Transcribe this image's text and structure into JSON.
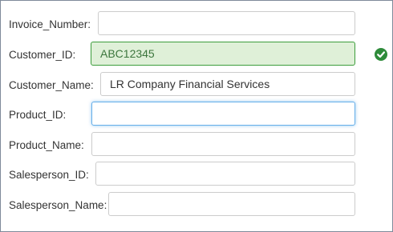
{
  "form": {
    "fields": [
      {
        "label": "Invoice_Number:",
        "value": ""
      },
      {
        "label": "Customer_ID:",
        "value": "ABC12345",
        "status": "valid"
      },
      {
        "label": "Customer_Name:",
        "value": "LR Company Financial Services"
      },
      {
        "label": "Product_ID:",
        "value": "",
        "state": "focused"
      },
      {
        "label": "Product_Name:",
        "value": ""
      },
      {
        "label": "Salesperson_ID:",
        "value": ""
      },
      {
        "label": "Salesperson_Name:",
        "value": ""
      }
    ],
    "valid_icon": "check-circle-icon",
    "colors": {
      "valid_bg": "#dff0d8",
      "valid_border": "#3c9d3c",
      "valid_text": "#3c763d",
      "focus_border": "#66afe9",
      "label_text": "#333333"
    }
  }
}
